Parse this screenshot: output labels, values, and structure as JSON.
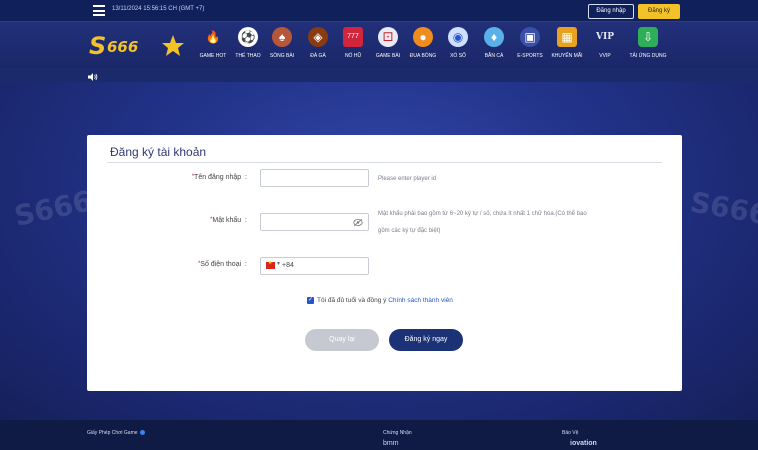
{
  "topbar": {
    "datetime": "13/11/2024 15:56:15 CH (GMT +7)",
    "login_label": "Đăng nhập",
    "register_label": "Đăng ký"
  },
  "brand": {
    "logo_text": "S666",
    "primary": "#1c3277",
    "accent": "#f2c228"
  },
  "nav": [
    {
      "label": "GAME HOT",
      "icon": "fire-icon"
    },
    {
      "label": "THỂ THAO",
      "icon": "soccer-ball-icon"
    },
    {
      "label": "SÒNG BÀI",
      "icon": "casino-dealer-icon"
    },
    {
      "label": "ĐÁ GÀ",
      "icon": "rooster-icon"
    },
    {
      "label": "NỔ HŨ",
      "icon": "slot-machine-icon"
    },
    {
      "label": "GAME BÀI",
      "icon": "dice-icon"
    },
    {
      "label": "ĐUA BÓNG",
      "icon": "racing-ball-icon"
    },
    {
      "label": "XỔ SỐ",
      "icon": "lottery-ball-icon"
    },
    {
      "label": "BẮN CÁ",
      "icon": "fish-icon"
    },
    {
      "label": "E-SPORTS",
      "icon": "gamepad-icon"
    },
    {
      "label": "KHUYẾN MÃI",
      "icon": "gift-icon"
    },
    {
      "label": "VVIP",
      "icon": "vip-icon"
    },
    {
      "label": "TẢI ỨNG DỤNG",
      "icon": "download-icon"
    }
  ],
  "form": {
    "title": "Đăng ký tài khoản",
    "username": {
      "label": "Tên đăng nhập",
      "value": "",
      "hint": "Please enter player id"
    },
    "password": {
      "label": "Mật khẩu",
      "value": "",
      "hint_line1": "Mật khẩu phải bao gồm từ 6~20 ký tự / số, chứa ít nhất 1 chữ hoa.(Có thể bao",
      "hint_line2": "gồm các ký tự đặc biệt)"
    },
    "phone": {
      "label": "Số điện thoại",
      "prefix": "+84",
      "value": ""
    },
    "colon": ":",
    "agree_text": "Tôi đã đủ tuổi và đồng ý",
    "agree_link": "Chính sách thành viên",
    "agree_checked": true,
    "back_label": "Quay lại",
    "submit_label": "Đăng ký ngay"
  },
  "footer": {
    "license_title": "Giấy Phép Chơi Game",
    "cert_title": "Chứng Nhận",
    "cert_logo": "bmm",
    "security_title": "Bảo Vệ",
    "security_logo": "iovation"
  }
}
